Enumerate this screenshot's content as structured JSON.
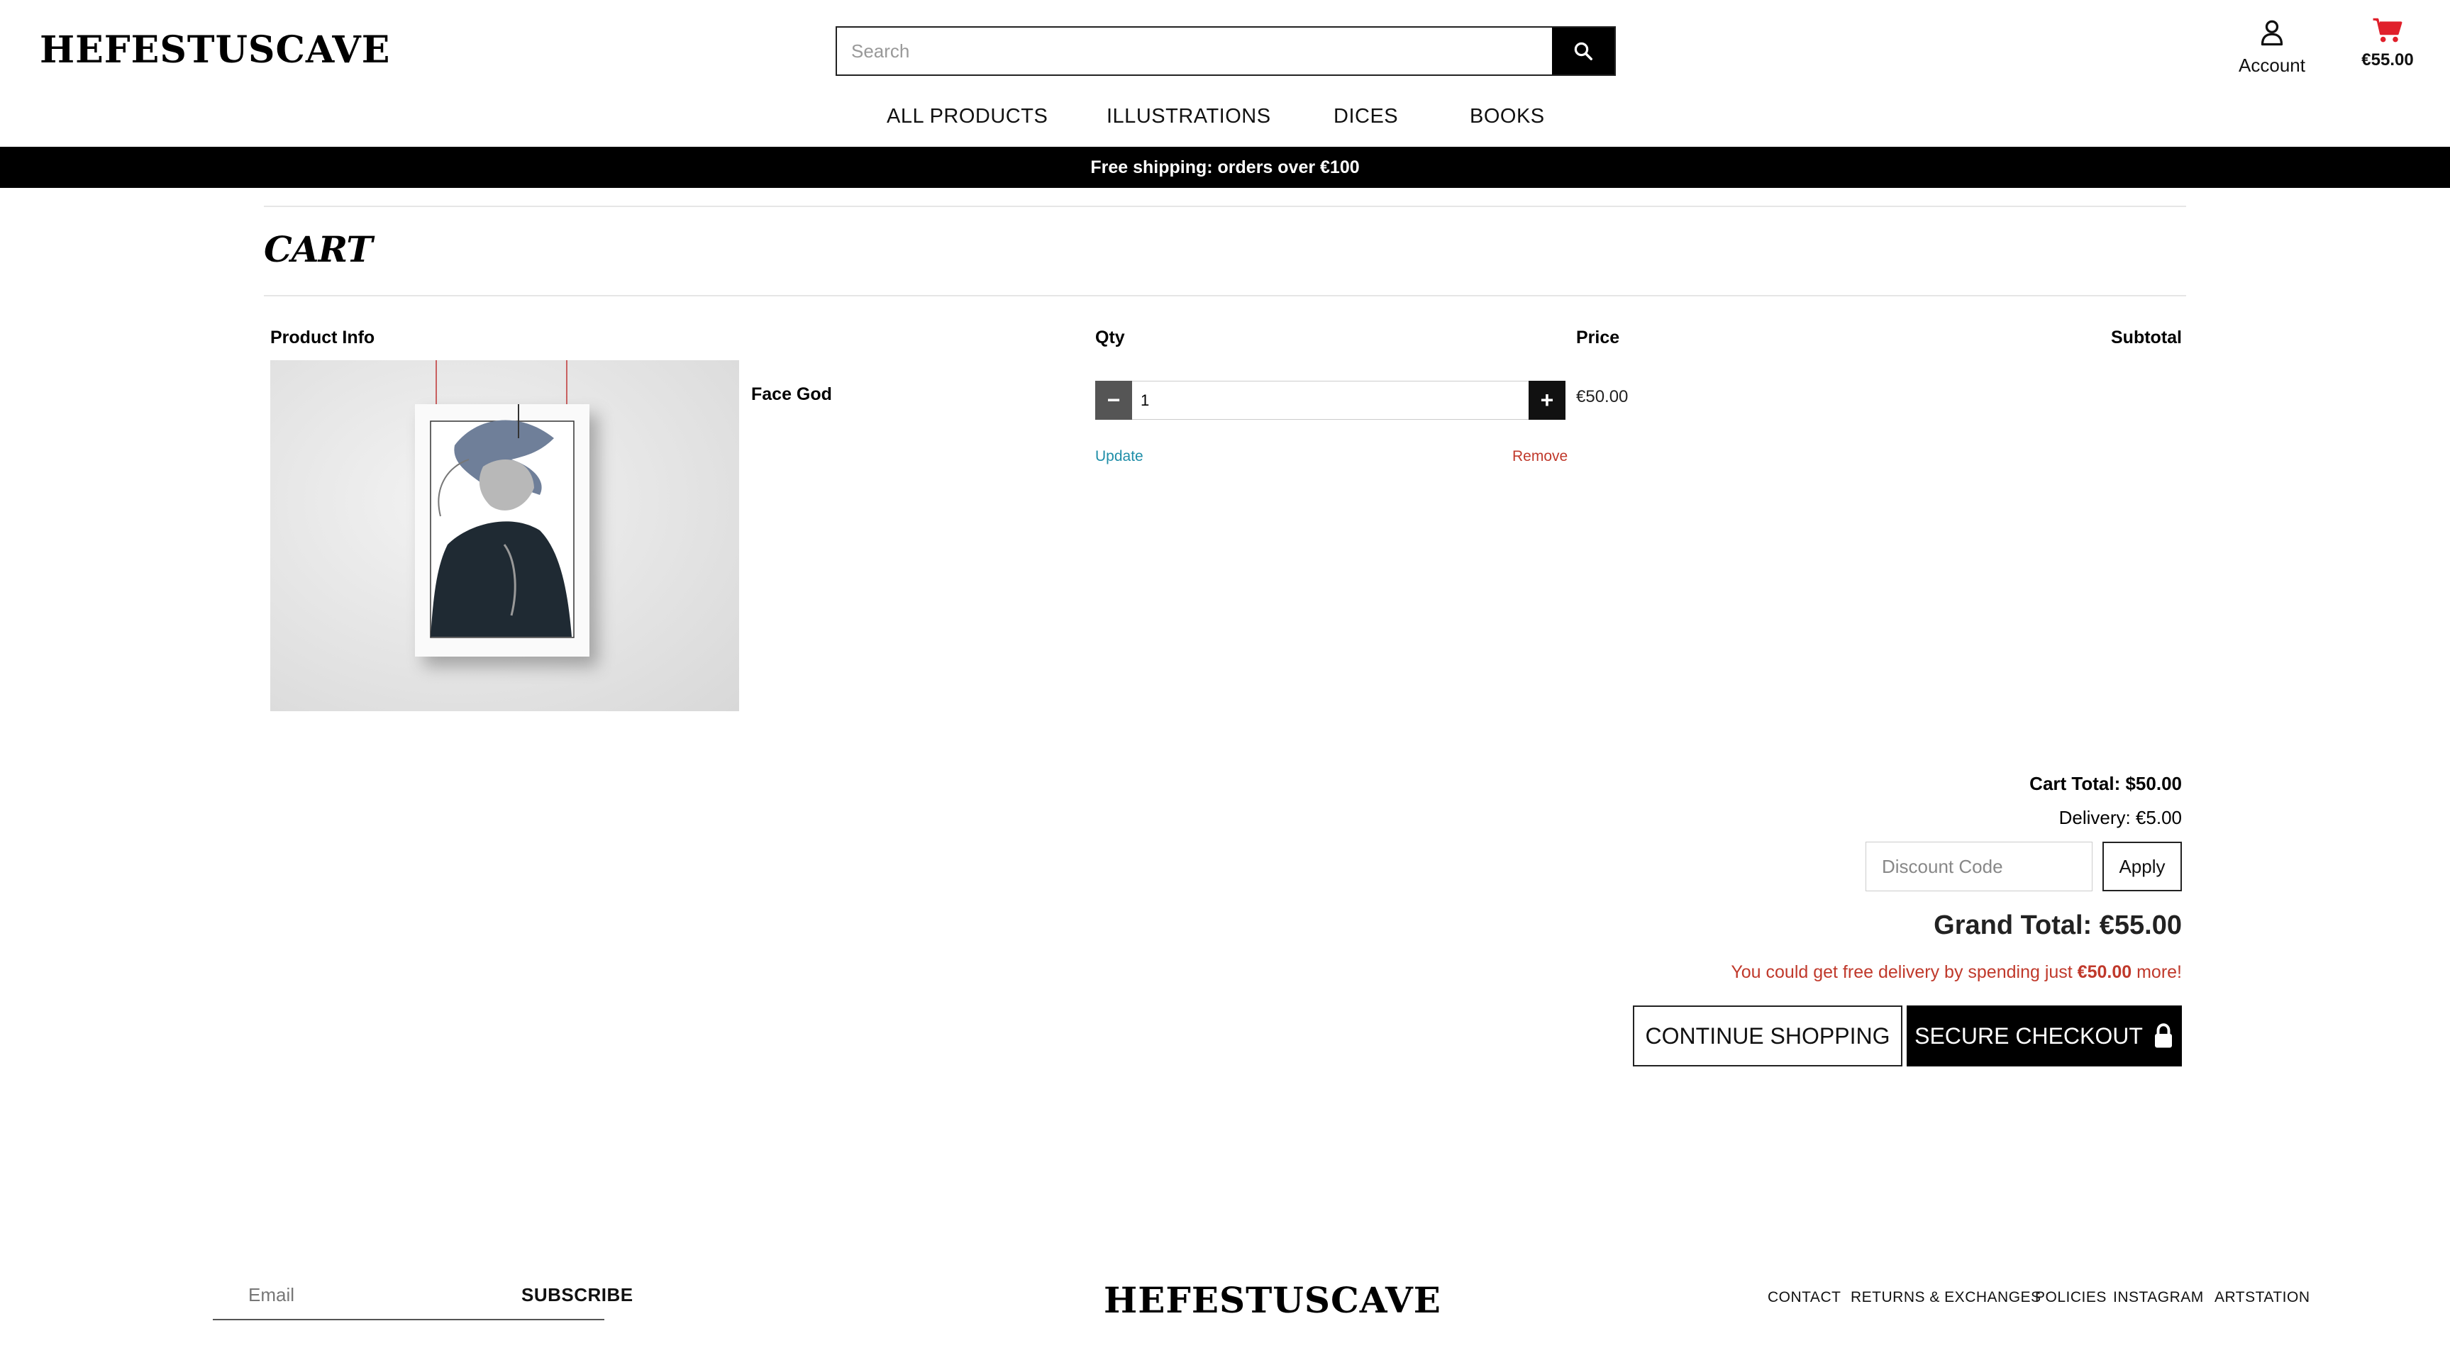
{
  "brand": {
    "logo_text": "HEFESTUSCAVE"
  },
  "header": {
    "search": {
      "placeholder": "Search"
    },
    "account_label": "Account",
    "cart_amount": "€55.00",
    "cart_icon_color": "#e0202b"
  },
  "nav": {
    "items": [
      "ALL PRODUCTS",
      "ILLUSTRATIONS",
      "DICES",
      "BOOKS"
    ]
  },
  "promo": {
    "text": "Free shipping: orders over €100"
  },
  "cart": {
    "title": "CART",
    "columns": {
      "product_info": "Product Info",
      "qty": "Qty",
      "price": "Price",
      "subtotal": "Subtotal"
    },
    "item": {
      "name": "Face God",
      "qty_minus": "−",
      "qty_plus": "+",
      "quantity": "1",
      "price": "€50.00",
      "update_label": "Update",
      "remove_label": "Remove"
    },
    "totals": {
      "cart_total": "Cart Total: $50.00",
      "delivery": "Delivery: €5.00",
      "discount_placeholder": "Discount Code",
      "apply_label": "Apply",
      "grand_total": "Grand Total: €55.00",
      "free_delivery_prefix": "You could get free delivery by spending just ",
      "free_delivery_amount": "€50.00",
      "free_delivery_suffix": " more!"
    },
    "continue_label": "CONTINUE SHOPPING",
    "checkout_label": "SECURE CHECKOUT"
  },
  "footer": {
    "email_placeholder": "Email",
    "subscribe_label": "SUBSCRIBE",
    "logo_text": "HEFESTUSCAVE",
    "links": [
      "CONTACT",
      "RETURNS & EXCHANGES",
      "POLICIES",
      "INSTAGRAM",
      "ARTSTATION"
    ]
  },
  "colors": {
    "promo_bar": "#000000",
    "link_update": "#1f8ea8",
    "link_remove": "#c0392b",
    "free_delivery_text": "#c0392b",
    "checkout_button": "#000000"
  }
}
